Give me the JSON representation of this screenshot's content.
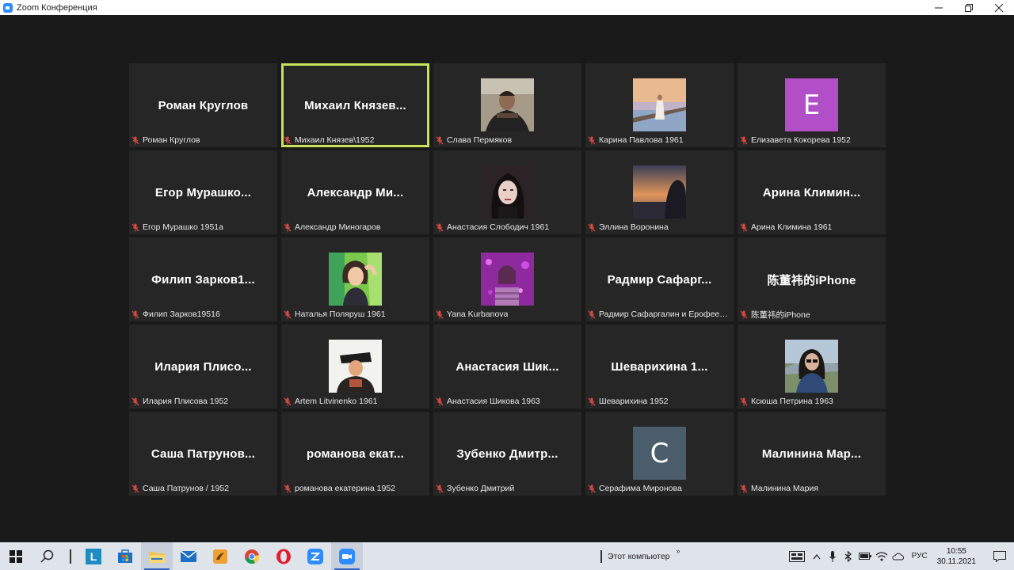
{
  "window": {
    "title": "Zoom Конференция"
  },
  "colors": {
    "background": "#1a1a1a",
    "tile": "#262626",
    "active_border": "#c6e35a",
    "mute": "#e0483e"
  },
  "tiles": [
    {
      "display": "Роман Круглов",
      "name": "Роман Круглов",
      "kind": "text"
    },
    {
      "display": "Михаил Князев...",
      "name": "Михаил Князев\\1952",
      "kind": "text",
      "active": true
    },
    {
      "display": "",
      "name": "Слава Пермяков",
      "kind": "photo",
      "photo": "man-at-desk"
    },
    {
      "display": "",
      "name": "Карина Павлова 1961",
      "kind": "photo",
      "photo": "woman-on-pier"
    },
    {
      "display": "E",
      "name": "Елизавета Кокорева 1952",
      "kind": "letter",
      "color": "#b34ec9"
    },
    {
      "display": "Егор Мурашко...",
      "name": "Егор Мурашко 1951а",
      "kind": "text"
    },
    {
      "display": "Александр Ми...",
      "name": "Александр Миногаров",
      "kind": "text"
    },
    {
      "display": "",
      "name": "Анастасия Слободич 1961",
      "kind": "photo",
      "photo": "woman-portrait"
    },
    {
      "display": "",
      "name": "Эллина Воронина",
      "kind": "photo",
      "photo": "sunset-silhouette"
    },
    {
      "display": "Арина Климин...",
      "name": "Арина Климина 1961",
      "kind": "text"
    },
    {
      "display": "Филип Зарков1...",
      "name": "Филип Зарков19516",
      "kind": "text"
    },
    {
      "display": "",
      "name": "Наталья Поляруш 1961",
      "kind": "photo",
      "photo": "cartoon-girl"
    },
    {
      "display": "",
      "name": "Yana Kurbanova",
      "kind": "photo",
      "photo": "purple-glitter"
    },
    {
      "display": "Радмир Сафарг...",
      "name": "Радмир Сафаргалин и Ерофеева ...",
      "kind": "text"
    },
    {
      "display": "陈董祎的iPhone",
      "name": "陈董祎的iPhone",
      "kind": "text"
    },
    {
      "display": "Илария Плисо...",
      "name": "Илария Плисова 1952",
      "kind": "text"
    },
    {
      "display": "",
      "name": "Artem Litvinenko 1961",
      "kind": "photo",
      "photo": "man-in-hat"
    },
    {
      "display": "Анастасия Шик...",
      "name": "Анастасия Шикова 1963",
      "kind": "text"
    },
    {
      "display": "Шеварихина 1...",
      "name": "Шеварихина 1952",
      "kind": "text"
    },
    {
      "display": "",
      "name": "Ксюша Петрина 1963",
      "kind": "photo",
      "photo": "woman-outdoors"
    },
    {
      "display": "Саша Патрунов...",
      "name": "Саша Патрунов / 1952",
      "kind": "text"
    },
    {
      "display": "романова екат...",
      "name": "романова екатерина 1952",
      "kind": "text"
    },
    {
      "display": "Зубенко Дмитр...",
      "name": "Зубенко Дмитрий",
      "kind": "text"
    },
    {
      "display": "C",
      "name": "Серафима Миронова",
      "kind": "letter",
      "color": "#4b5d6b"
    },
    {
      "display": "Малинина Мар...",
      "name": "Малинина Мария",
      "kind": "text"
    }
  ],
  "taskbar": {
    "apps": [
      "windows-start-icon",
      "search-icon",
      "lingualeo-icon",
      "store-icon",
      "file-explorer-icon",
      "mail-icon",
      "paint-icon",
      "chrome-icon",
      "opera-icon",
      "zoom-icon",
      "zoom-meeting-icon"
    ],
    "toolbar_label": "Этот компьютер",
    "language": "РУС",
    "time": "10:55",
    "date": "30.11.2021"
  }
}
